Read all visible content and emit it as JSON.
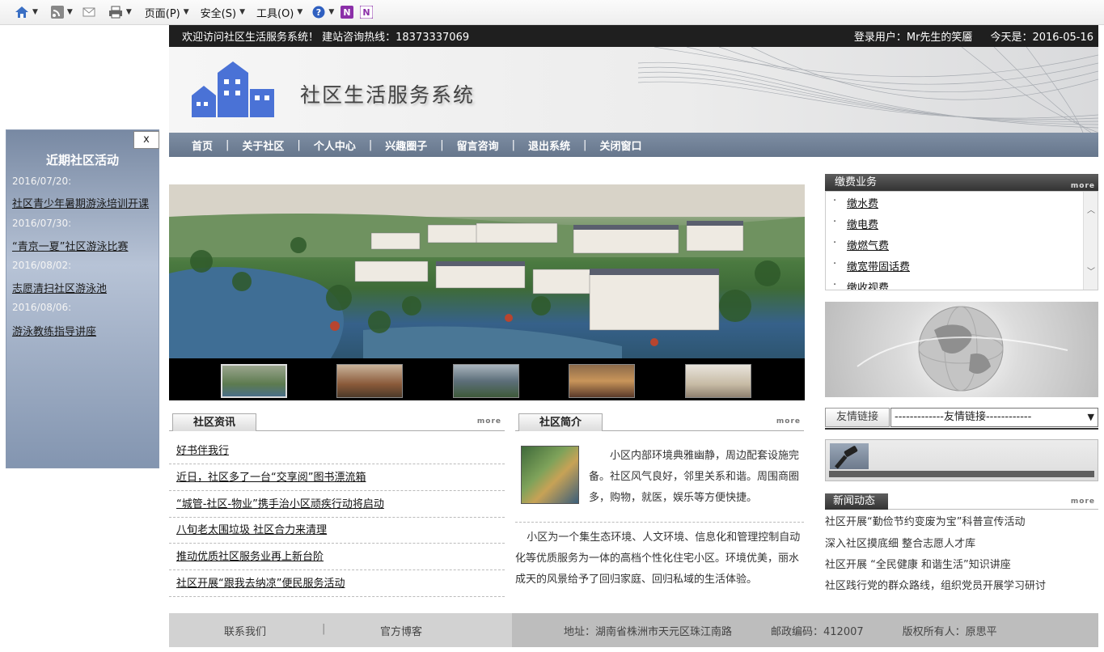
{
  "browser_toolbar": {
    "page_menu": "页面(P)",
    "safety_menu": "安全(S)",
    "tools_menu": "工具(O)"
  },
  "topbar": {
    "welcome": "欢迎访问社区生活服务系统！ 建站咨询热线：18373337069",
    "user": "登录用户：Mr先生的笑靥",
    "today": "今天是：2016-05-16"
  },
  "site": {
    "title": "社区生活服务系统"
  },
  "nav": [
    "首页",
    "关于社区",
    "个人中心",
    "兴趣圈子",
    "留言咨询",
    "退出系统",
    "关闭窗口"
  ],
  "nav_sep": "|",
  "float_panel": {
    "close": "x",
    "title": "近期社区活动",
    "events": [
      {
        "date": "2016/07/20:",
        "name": "社区青少年暑期游泳培训开课"
      },
      {
        "date": "2016/07/30:",
        "name": "“青京一夏”社区游泳比赛"
      },
      {
        "date": "2016/08/02:",
        "name": "志愿清扫社区游泳池"
      },
      {
        "date": "2016/08/06:",
        "name": "游泳教练指导讲座"
      }
    ]
  },
  "news": {
    "tab": "社区资讯",
    "more": "more",
    "items": [
      "好书伴我行",
      "近日，社区多了一台“交享阅”图书漂流箱",
      "“城管-社区-物业”携手治小区顽疾行动将启动",
      "八旬老太围垃圾 社区合力来清理",
      "推动优质社区服务业再上新台阶",
      "社区开展“跟我去纳凉”便民服务活动"
    ]
  },
  "intro": {
    "tab": "社区简介",
    "more": "more",
    "para1": "小区内部环境典雅幽静，周边配套设施完备。社区风气良好，邻里关系和谐。周围商圈多，购物，就医，娱乐等方便快捷。",
    "para2": "小区为一个集生态环境、人文环境、信息化和管理控制自动化等优质服务为一体的高档个性化住宅小区。环境优美，丽水成天的风景给予了回归家庭、回归私域的生活体验。"
  },
  "payments": {
    "title": "缴费业务",
    "more": "more",
    "bullet": "·",
    "items": [
      "缴水费",
      "缴电费",
      "缴燃气费",
      "缴宽带固话费",
      "缴收视费"
    ]
  },
  "links": {
    "label": "友情链接",
    "select": "-------------友情链接------------"
  },
  "news_right": {
    "title": "新闻动态",
    "more": "more",
    "items": [
      "社区开展“勤俭节约变废为宝”科普宣传活动",
      "深入社区摸底细 整合志愿人才库",
      "社区开展 “全民健康 和谐生活”知识讲座",
      "社区践行党的群众路线，组织党员开展学习研讨"
    ]
  },
  "footer": {
    "contact": "联系我们",
    "sep": "|",
    "blog": "官方博客",
    "address": "地址：湖南省株洲市天元区珠江南路",
    "postcode": "邮政编码：412007",
    "copyright": "版权所有人：原思平"
  },
  "colors": {
    "nav": "#6d7d93",
    "topbar": "#1f1f1f",
    "float_panel": "#9aa9c0",
    "footer": "#d2d2d2"
  }
}
